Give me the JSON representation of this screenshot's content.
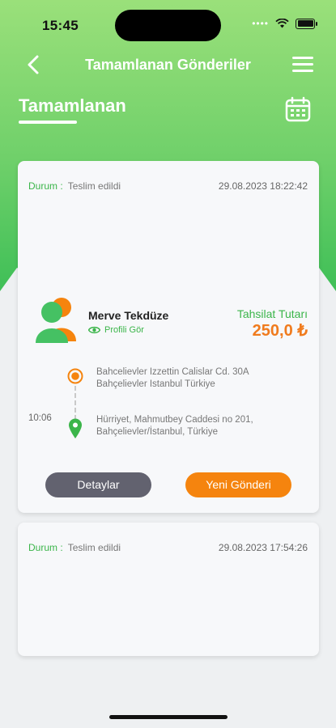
{
  "status_bar": {
    "time": "15:45"
  },
  "header": {
    "title": "Tamamlanan Gönderiler"
  },
  "section": {
    "title": "Tamamlanan"
  },
  "colors": {
    "green": "#3bb54a",
    "orange": "#f5840e",
    "gray_button": "#62626f"
  },
  "shipments": [
    {
      "status_label": "Durum :",
      "status_value": "Teslim edildi",
      "date": "29.08.2023 18:22:42",
      "recipient_name": "Merve Tekdüze",
      "profile_link": "Profili Gör",
      "amount_label": "Tahsilat Tutarı",
      "amount_value": "250,0 ₺",
      "pickup_address": "Bahcelievler Izzettin Calislar Cd. 30A Bahçelievler Istanbul Türkiye",
      "delivery_time": "10:06",
      "delivery_address": "Hürriyet, Mahmutbey Caddesi no 201, Bahçelievler/İstanbul, Türkiye",
      "details_button": "Detaylar",
      "new_shipment_button": "Yeni Gönderi"
    },
    {
      "status_label": "Durum :",
      "status_value": "Teslim edildi",
      "date": "29.08.2023 17:54:26"
    }
  ]
}
